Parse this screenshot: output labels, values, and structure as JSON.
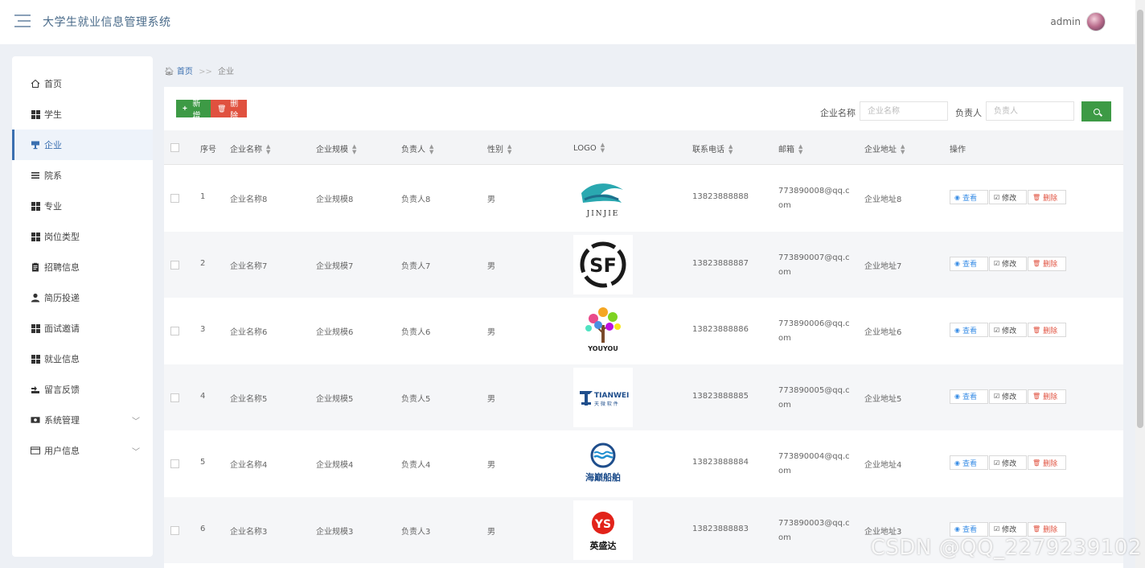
{
  "header": {
    "title": "大学生就业信息管理系统",
    "user": "admin"
  },
  "sidebar": {
    "items": [
      {
        "label": "首页",
        "icon": "home-icon"
      },
      {
        "label": "学生",
        "icon": "grid-icon"
      },
      {
        "label": "企业",
        "icon": "building-icon",
        "active": true
      },
      {
        "label": "院系",
        "icon": "list-icon"
      },
      {
        "label": "专业",
        "icon": "grid-icon"
      },
      {
        "label": "岗位类型",
        "icon": "grid-icon"
      },
      {
        "label": "招聘信息",
        "icon": "clipboard-icon"
      },
      {
        "label": "简历投递",
        "icon": "user-icon"
      },
      {
        "label": "面试邀请",
        "icon": "grid-icon"
      },
      {
        "label": "就业信息",
        "icon": "grid-icon"
      },
      {
        "label": "留言反馈",
        "icon": "message-icon"
      },
      {
        "label": "系统管理",
        "icon": "settings-icon",
        "expandable": true
      },
      {
        "label": "用户信息",
        "icon": "card-icon",
        "expandable": true
      }
    ]
  },
  "breadcrumb": {
    "home": "首页",
    "sep": ">>",
    "current": "企业"
  },
  "toolbar": {
    "add_label": "新增",
    "delete_label": "删除",
    "company_label": "企业名称",
    "company_placeholder": "企业名称",
    "manager_label": "负责人",
    "manager_placeholder": "负责人"
  },
  "table": {
    "columns": [
      "序号",
      "企业名称",
      "企业规模",
      "负责人",
      "性别",
      "LOGO",
      "联系电话",
      "邮箱",
      "企业地址",
      "操作"
    ],
    "actions": {
      "view": "查看",
      "edit": "修改",
      "delete": "删除"
    },
    "rows": [
      {
        "index": "1",
        "name": "企业名称8",
        "scale": "企业规模8",
        "manager": "负责人8",
        "gender": "男",
        "logo": "JINJIE",
        "phone": "13823888888",
        "email": "773890008@qq.com",
        "address": "企业地址8"
      },
      {
        "index": "2",
        "name": "企业名称7",
        "scale": "企业规模7",
        "manager": "负责人7",
        "gender": "男",
        "logo": "SF",
        "phone": "13823888887",
        "email": "773890007@qq.com",
        "address": "企业地址7"
      },
      {
        "index": "3",
        "name": "企业名称6",
        "scale": "企业规模6",
        "manager": "负责人6",
        "gender": "男",
        "logo": "YOUYOU",
        "phone": "13823888886",
        "email": "773890006@qq.com",
        "address": "企业地址6"
      },
      {
        "index": "4",
        "name": "企业名称5",
        "scale": "企业规模5",
        "manager": "负责人5",
        "gender": "男",
        "logo": "TIANWEI",
        "phone": "13823888885",
        "email": "773890005@qq.com",
        "address": "企业地址5"
      },
      {
        "index": "5",
        "name": "企业名称4",
        "scale": "企业规模4",
        "manager": "负责人4",
        "gender": "男",
        "logo": "海巅船舶",
        "phone": "13823888884",
        "email": "773890004@qq.com",
        "address": "企业地址4"
      },
      {
        "index": "6",
        "name": "企业名称3",
        "scale": "企业规模3",
        "manager": "负责人3",
        "gender": "男",
        "logo": "英盛达",
        "phone": "13823888883",
        "email": "773890003@qq.com",
        "address": "企业地址3"
      }
    ]
  },
  "watermark": "CSDN @QQ_2279239102",
  "colors": {
    "primary": "#3a6fb0",
    "success": "#3d9a45",
    "danger": "#e0513f"
  }
}
